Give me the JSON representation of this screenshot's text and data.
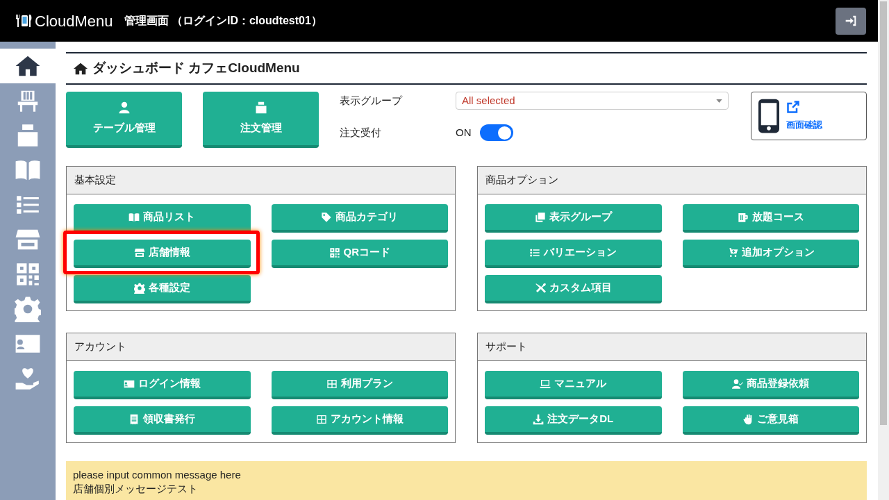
{
  "header": {
    "brand": "CloudMenu",
    "title": "管理画面 （ログインID：cloudtest01）"
  },
  "sidebar": {
    "items": [
      {
        "selected": true
      },
      {
        "selected": false
      },
      {
        "selected": false
      },
      {
        "selected": false
      },
      {
        "selected": false
      },
      {
        "selected": false
      },
      {
        "selected": false
      },
      {
        "selected": false
      },
      {
        "selected": false
      },
      {
        "selected": false
      }
    ]
  },
  "page_title": "ダッシュボード カフェCloudMenu",
  "quick_buttons": [
    {
      "label": "テーブル管理"
    },
    {
      "label": "注文管理"
    }
  ],
  "display_group": {
    "label": "表示グループ",
    "value": "All selected"
  },
  "order_accept": {
    "label": "注文受付",
    "value_label": "ON",
    "on": true
  },
  "preview": {
    "label": "画面確認"
  },
  "panels": [
    {
      "title": "基本設定",
      "buttons": [
        {
          "label": "商品リスト",
          "highlighted": false
        },
        {
          "label": "商品カテゴリ",
          "highlighted": false
        },
        {
          "label": "店舗情報",
          "highlighted": true
        },
        {
          "label": "QRコード",
          "highlighted": false
        },
        {
          "label": "各種設定",
          "highlighted": false
        }
      ]
    },
    {
      "title": "商品オプション",
      "buttons": [
        {
          "label": "表示グループ",
          "highlighted": false
        },
        {
          "label": "放題コース",
          "highlighted": false
        },
        {
          "label": "バリエーション",
          "highlighted": false
        },
        {
          "label": "追加オプション",
          "highlighted": false
        },
        {
          "label": "カスタム項目",
          "highlighted": false
        }
      ]
    },
    {
      "title": "アカウント",
      "buttons": [
        {
          "label": "ログイン情報",
          "highlighted": false
        },
        {
          "label": "利用プラン",
          "highlighted": false
        },
        {
          "label": "領収書発行",
          "highlighted": false
        },
        {
          "label": "アカウント情報",
          "highlighted": false
        }
      ]
    },
    {
      "title": "サポート",
      "buttons": [
        {
          "label": "マニュアル",
          "highlighted": false
        },
        {
          "label": "商品登録依頼",
          "highlighted": false
        },
        {
          "label": "注文データDL",
          "highlighted": false
        },
        {
          "label": "ご意見箱",
          "highlighted": false
        }
      ]
    }
  ],
  "message": {
    "lines": [
      "please input common message here",
      "店舗個別メッセージテスト"
    ]
  }
}
